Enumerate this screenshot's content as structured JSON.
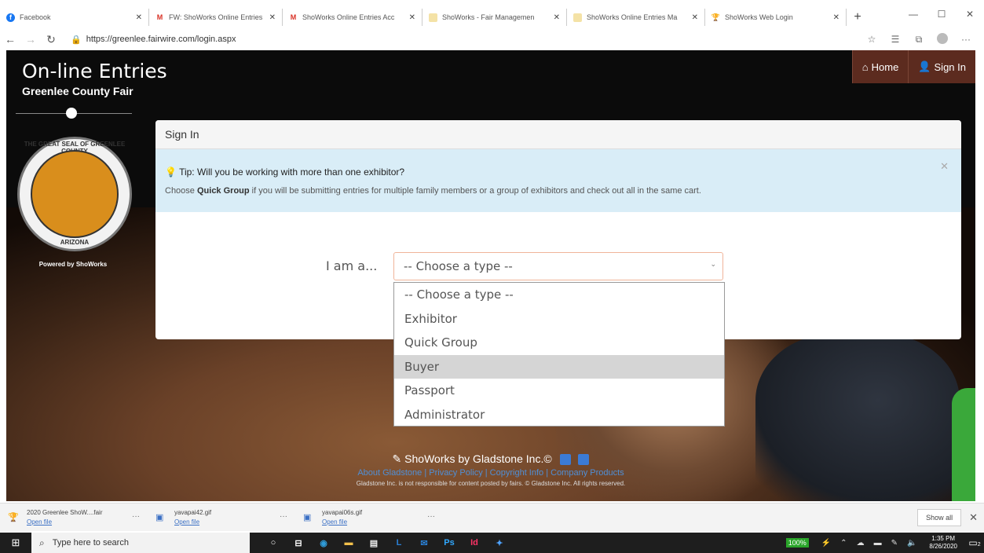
{
  "browser": {
    "tabs": [
      {
        "label": "Facebook",
        "icon": "facebook-icon"
      },
      {
        "label": "FW: ShoWorks Online Entries",
        "icon": "gmail-icon"
      },
      {
        "label": "ShoWorks Online Entries Acc",
        "icon": "gmail-icon"
      },
      {
        "label": "ShoWorks - Fair Managemen",
        "icon": "showorks-icon"
      },
      {
        "label": "ShoWorks Online Entries Ma",
        "icon": "showorks-icon"
      },
      {
        "label": "ShoWorks Web Login",
        "icon": "trophy-icon",
        "active": true
      }
    ],
    "url": "https://greenlee.fairwire.com/login.aspx"
  },
  "site": {
    "title": "On-line Entries",
    "subtitle": "Greenlee County Fair",
    "seal_top": "THE GREAT SEAL OF GREENLEE COUNTY",
    "seal_bottom": "ARIZONA",
    "powered_by": "Powered by ShoWorks",
    "nav": {
      "home": "Home",
      "sign_in": "Sign In"
    }
  },
  "signin": {
    "heading": "Sign In",
    "tip_title": "Tip: Will you be working with more than one exhibitor?",
    "tip_before": "Choose ",
    "tip_bold": "Quick Group",
    "tip_after": " if you will be submitting entries for multiple family members or a group of exhibitors and check out all in the same cart.",
    "label": "I am a...",
    "select_value": "-- Choose a type --",
    "options": [
      "-- Choose a type --",
      "Exhibitor",
      "Quick Group",
      "Buyer",
      "Passport",
      "Administrator"
    ],
    "highlighted_option": "Buyer"
  },
  "footer": {
    "brand": "ShoWorks by Gladstone Inc.©",
    "links": "About Gladstone | Privacy Policy | Copyright Info | Company Products",
    "disclaimer": "Gladstone Inc. is not responsible for content posted by fairs. © Gladstone Inc. All rights reserved."
  },
  "downloads": {
    "items": [
      {
        "name": "2020 Greenlee ShoW....fair",
        "action": "Open file"
      },
      {
        "name": "yavapai42.gif",
        "action": "Open file"
      },
      {
        "name": "yavapai06s.gif",
        "action": "Open file"
      }
    ],
    "show_all": "Show all"
  },
  "taskbar": {
    "search_placeholder": "Type here to search",
    "battery": "100%",
    "time": "1:35 PM",
    "date": "8/26/2020",
    "notifications": "2"
  }
}
